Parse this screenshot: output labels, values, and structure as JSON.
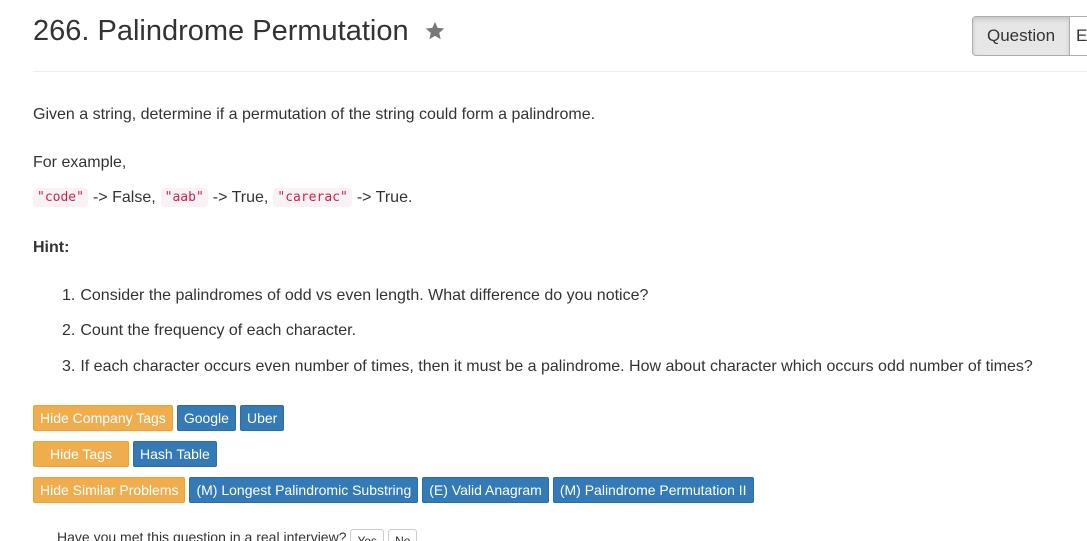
{
  "problem": {
    "title": "266. Palindrome Permutation",
    "star_icon": "star-icon"
  },
  "tabs": [
    {
      "label": "Question"
    },
    {
      "label": "E"
    }
  ],
  "content": {
    "description": "Given a string, determine if a permutation of the string could form a palindrome.",
    "example_label": "For example,",
    "examples": [
      {
        "code": "\"code\"",
        "result": "-> False,"
      },
      {
        "code": "\"aab\"",
        "result": "-> True,"
      },
      {
        "code": "\"carerac\"",
        "result": "-> True."
      }
    ],
    "hint_label": "Hint:",
    "hints": [
      {
        "num": "1.",
        "text": "Consider the palindromes of odd vs even length. What difference do you notice?"
      },
      {
        "num": "2.",
        "text": "Count the frequency of each character."
      },
      {
        "num": "3.",
        "text": "If each character occurs even number of times, then it must be a palindrome. How about character which occurs odd number of times?"
      }
    ]
  },
  "company_tags": {
    "toggle_label": "Hide Company Tags",
    "tags": [
      "Google",
      "Uber"
    ]
  },
  "topic_tags": {
    "toggle_label": "Hide Tags",
    "tags": [
      "Hash Table"
    ]
  },
  "similar_problems": {
    "toggle_label": "Hide Similar Problems",
    "items": [
      "(M) Longest Palindromic Substring",
      "(E) Valid Anagram",
      "(M) Palindrome Permutation II"
    ]
  },
  "interview": {
    "question": "Have you met this question in a real interview?",
    "yes_label": "Yes",
    "no_label": "No"
  },
  "colors": {
    "warning": "#f0ad4e",
    "primary": "#337ab7",
    "code_text": "#c7254e",
    "code_bg": "#f9f2f4"
  }
}
